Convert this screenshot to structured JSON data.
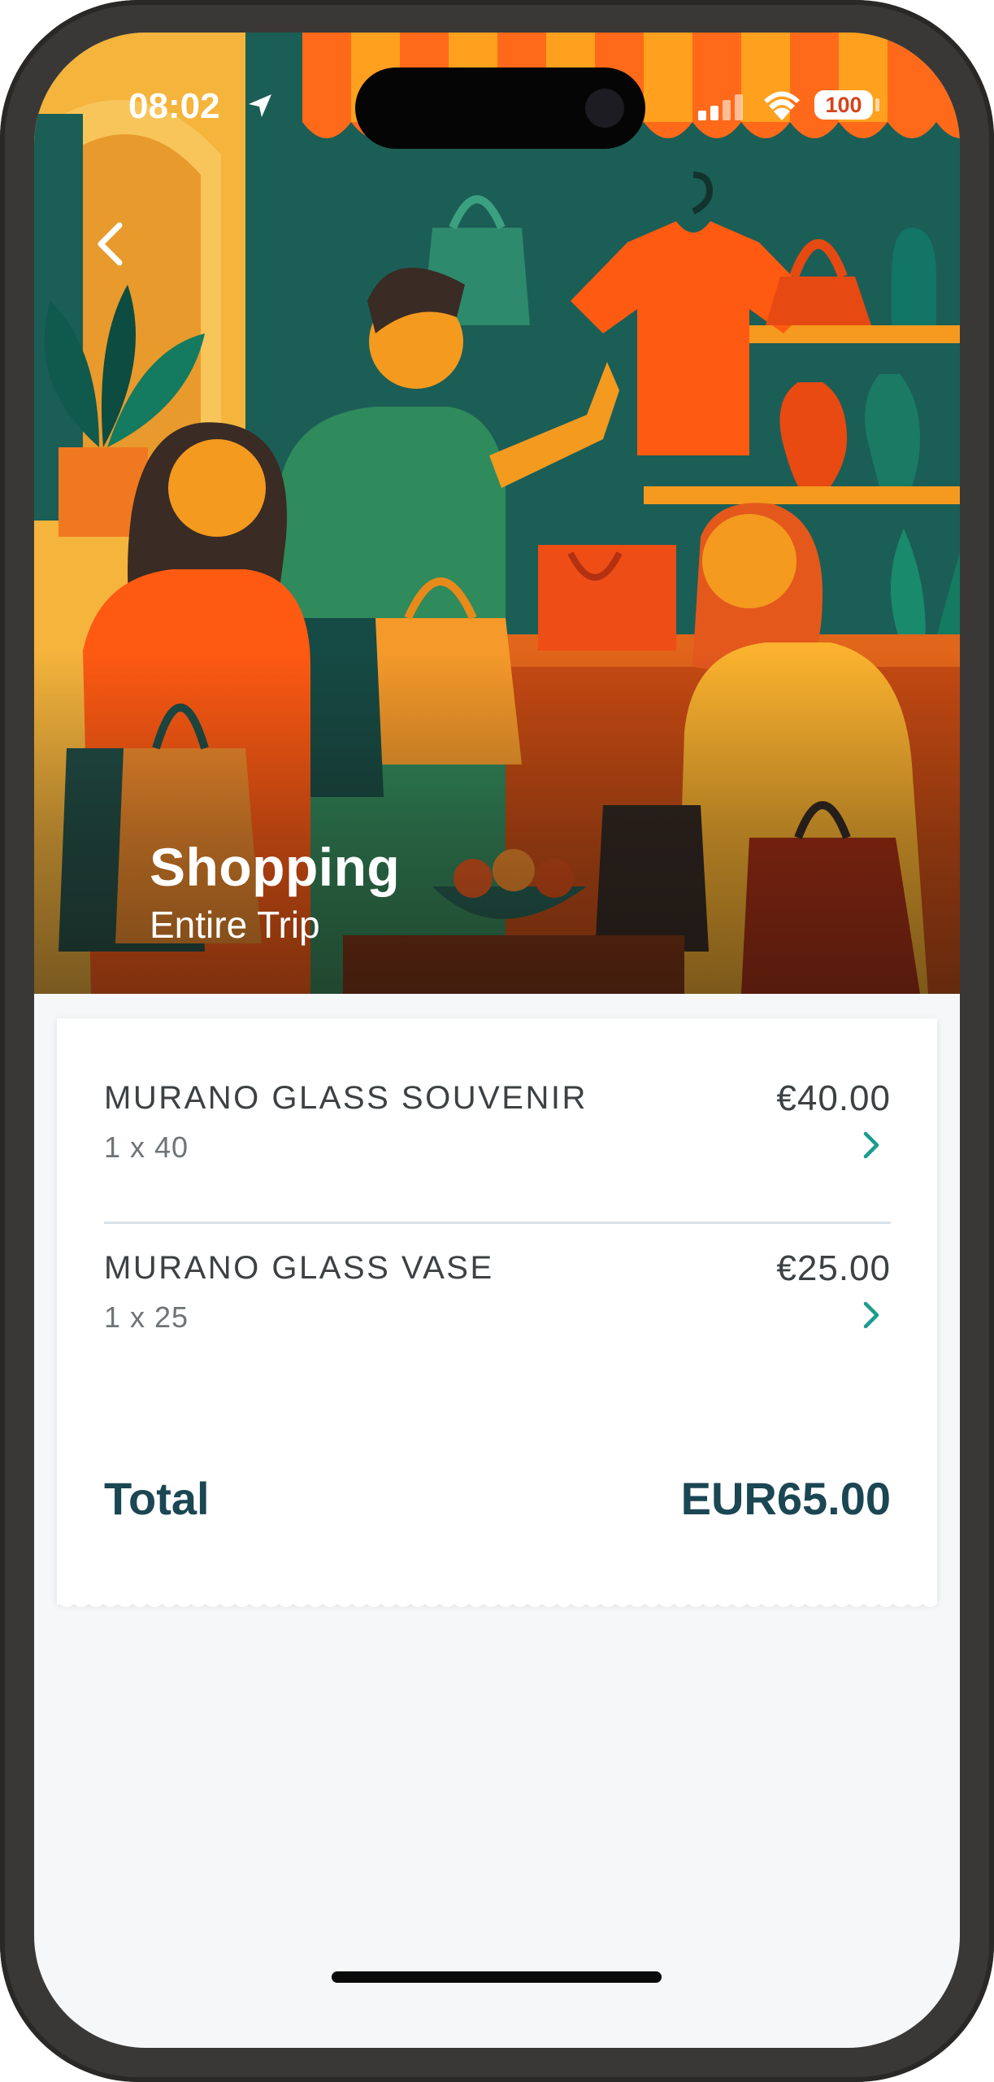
{
  "status_bar": {
    "time": "08:02",
    "battery": "100"
  },
  "header": {
    "title": "Shopping",
    "subtitle": "Entire Trip"
  },
  "items": [
    {
      "name": "MURANO GLASS SOUVENIR",
      "quantity": "1 x 40",
      "price": "€40.00"
    },
    {
      "name": "MURANO GLASS VASE",
      "quantity": "1 x 25",
      "price": "€25.00"
    }
  ],
  "total": {
    "label": "Total",
    "value": "EUR65.00"
  },
  "colors": {
    "accent": "#1a9c8e",
    "heading": "#1b4653",
    "background": "#f5f7f9"
  },
  "icons": {
    "back": "chevron-left-icon",
    "item_action": "chevron-right-icon"
  }
}
